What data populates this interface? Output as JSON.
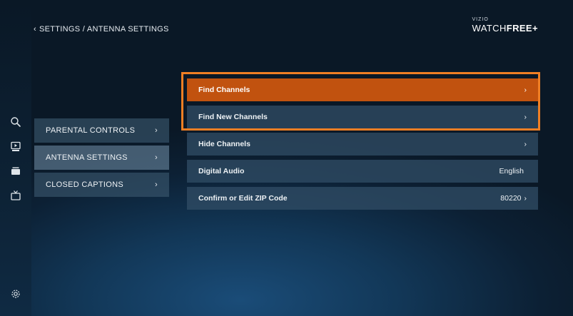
{
  "breadcrumb": {
    "back_glyph": "‹",
    "path": "SETTINGS / ANTENNA SETTINGS"
  },
  "brand": {
    "top": "VIZIO",
    "main_light": "WATCH",
    "main_bold": "FREE+"
  },
  "rail_icons": [
    "search-icon",
    "watchfree-icon",
    "library-icon",
    "live-tv-icon",
    "gear-icon"
  ],
  "left_menu": {
    "items": [
      {
        "label": "PARENTAL CONTROLS",
        "chevron": "›"
      },
      {
        "label": "ANTENNA SETTINGS",
        "chevron": "›"
      },
      {
        "label": "CLOSED CAPTIONS",
        "chevron": "›"
      }
    ]
  },
  "right_menu": {
    "items": [
      {
        "label": "Find Channels",
        "value": "",
        "chevron": "›"
      },
      {
        "label": "Find New Channels",
        "value": "",
        "chevron": "›"
      },
      {
        "label": "Hide Channels",
        "value": "",
        "chevron": "›"
      },
      {
        "label": "Digital Audio",
        "value": "English",
        "chevron": ""
      },
      {
        "label": "Confirm or Edit ZIP Code",
        "value": "80220",
        "chevron": "›"
      }
    ]
  },
  "colors": {
    "focus": "#c1520f",
    "highlight": "#f07f24",
    "background": "#0c2034"
  }
}
